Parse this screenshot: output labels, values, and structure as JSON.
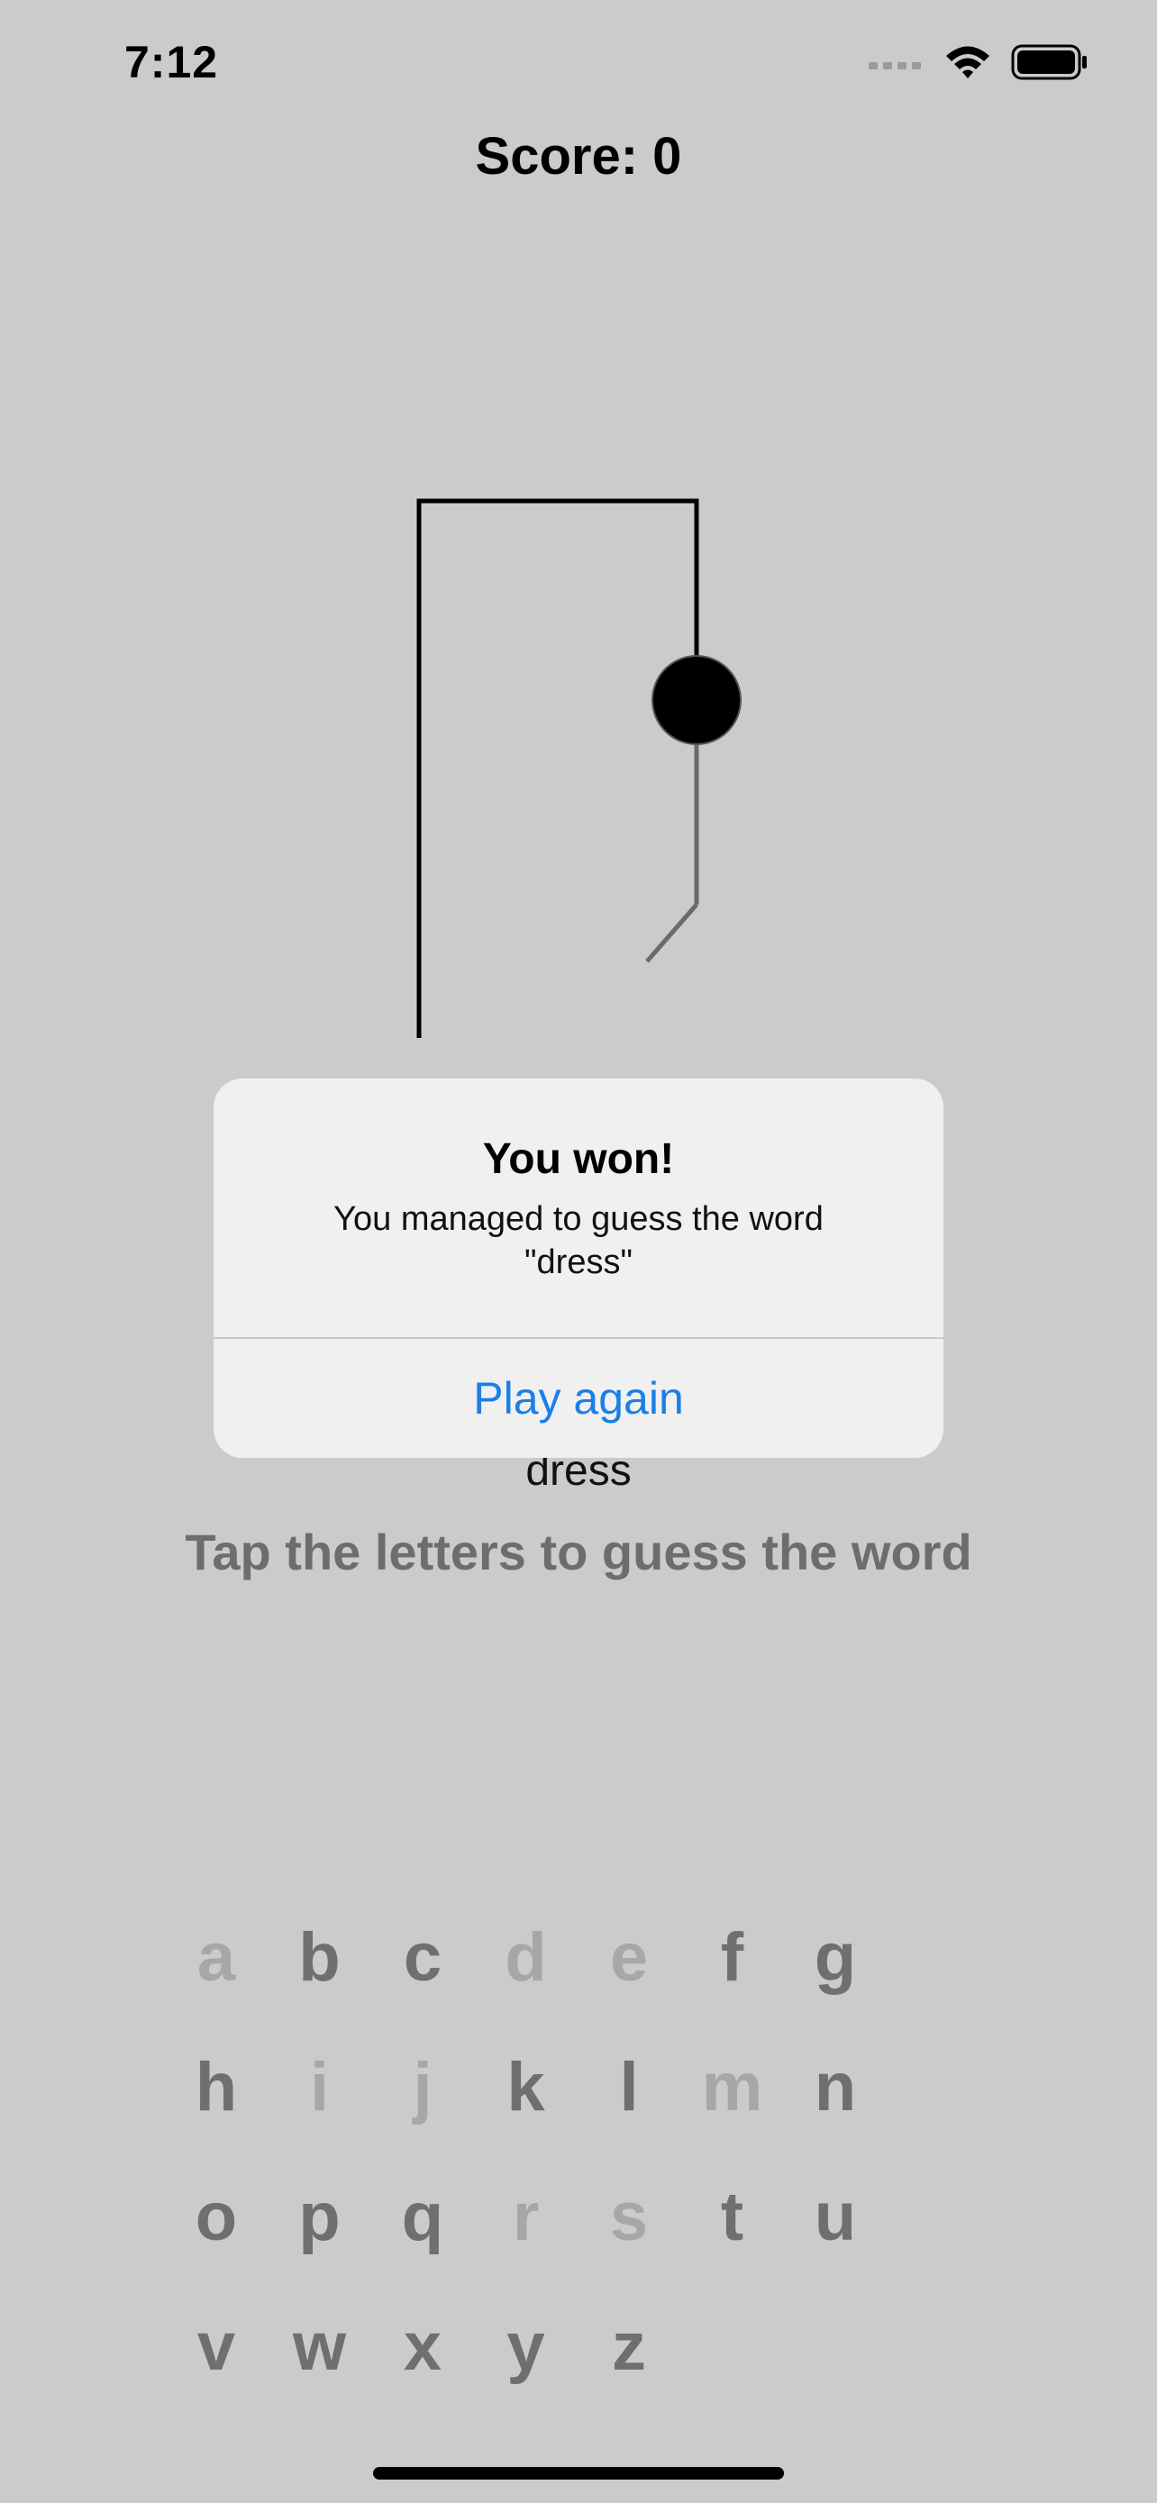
{
  "status_bar": {
    "time": "7:12"
  },
  "game": {
    "score_label": "Score: 0",
    "word": "dress",
    "hint": "Tap the letters to guess the word"
  },
  "keyboard": {
    "keys": [
      {
        "letter": "a",
        "used": true
      },
      {
        "letter": "b",
        "used": false
      },
      {
        "letter": "c",
        "used": false
      },
      {
        "letter": "d",
        "used": true
      },
      {
        "letter": "e",
        "used": true
      },
      {
        "letter": "f",
        "used": false
      },
      {
        "letter": "g",
        "used": false
      },
      {
        "letter": "h",
        "used": false
      },
      {
        "letter": "i",
        "used": true
      },
      {
        "letter": "j",
        "used": true
      },
      {
        "letter": "k",
        "used": false
      },
      {
        "letter": "l",
        "used": false
      },
      {
        "letter": "m",
        "used": true
      },
      {
        "letter": "n",
        "used": false
      },
      {
        "letter": "o",
        "used": false
      },
      {
        "letter": "p",
        "used": false
      },
      {
        "letter": "q",
        "used": false
      },
      {
        "letter": "r",
        "used": true
      },
      {
        "letter": "s",
        "used": true
      },
      {
        "letter": "t",
        "used": false
      },
      {
        "letter": "u",
        "used": false
      },
      {
        "letter": "v",
        "used": false
      },
      {
        "letter": "w",
        "used": false
      },
      {
        "letter": "x",
        "used": false
      },
      {
        "letter": "y",
        "used": false
      },
      {
        "letter": "z",
        "used": false
      }
    ]
  },
  "alert": {
    "title": "You won!",
    "message": "You managed to guess the word \"dress\"",
    "button_label": "Play again"
  },
  "colors": {
    "background": "#cbcbcb",
    "accent": "#1a7fe8"
  },
  "icons": [
    "cellular-signal-icon",
    "wifi-icon",
    "battery-icon"
  ]
}
